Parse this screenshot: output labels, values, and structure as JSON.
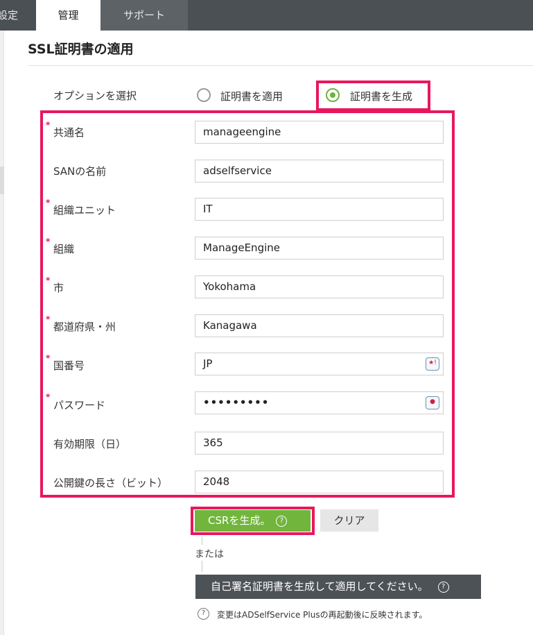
{
  "tabs": [
    {
      "label": "設定"
    },
    {
      "label": "管理"
    },
    {
      "label": "サポート"
    }
  ],
  "page_title": "SSL証明書の適用",
  "option": {
    "label": "オプションを選択",
    "apply_label": "証明書を適用",
    "generate_label": "証明書を生成",
    "selected": "証明書を生成"
  },
  "form": {
    "required_mark": "*",
    "fields": [
      {
        "label": "共通名",
        "value": "manageengine",
        "required": true
      },
      {
        "label": "SANの名前",
        "value": "adselfservice",
        "required": false
      },
      {
        "label": "組織ユニット",
        "value": "IT",
        "required": true
      },
      {
        "label": "組織",
        "value": "ManageEngine",
        "required": true
      },
      {
        "label": "市",
        "value": "Yokohama",
        "required": true
      },
      {
        "label": "都道府県・州",
        "value": "Kanagawa",
        "required": true
      },
      {
        "label": "国番号",
        "value": "JP",
        "required": true
      },
      {
        "label": "パスワード",
        "value": "•••••••••",
        "required": true
      },
      {
        "label": "有効期限（日）",
        "value": "365",
        "required": false
      },
      {
        "label": "公開鍵の長さ（ビット）",
        "value": "2048",
        "required": false
      }
    ]
  },
  "buttons": {
    "generate_csr": "CSRを生成。",
    "clear": "クリア",
    "or_text": "または",
    "self_signed": "自己署名証明書を生成して適用してください。",
    "help_glyph": "?"
  },
  "note": "変更はADSelfService Plusの再起動後に反映されます。",
  "colors": {
    "highlight": "#e8175d",
    "accent_green": "#71b53d",
    "topbar": "#4b5054"
  },
  "icons": {
    "country_field": "password-manager-icon",
    "password_field": "password-manager-icon",
    "help": "question-circle-icon"
  }
}
